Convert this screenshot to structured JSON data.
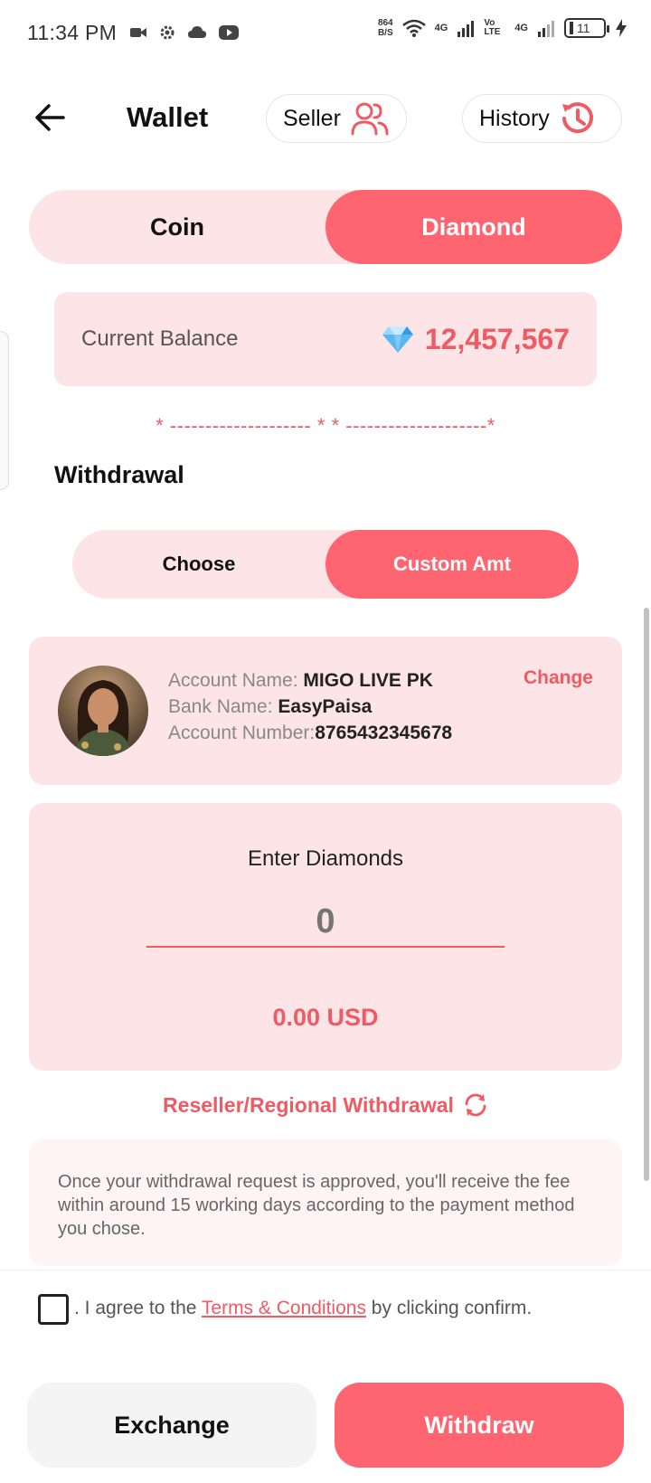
{
  "status_bar": {
    "time": "11:34 PM",
    "speed_value": "864",
    "speed_unit": "B/S",
    "net1": "4G",
    "net_volte": "Vo LTE",
    "net2": "4G",
    "battery": "11"
  },
  "header": {
    "title": "Wallet",
    "seller_label": "Seller",
    "history_label": "History"
  },
  "main_tabs": [
    {
      "label": "Coin",
      "active": false
    },
    {
      "label": "Diamond",
      "active": true
    }
  ],
  "balance": {
    "label": "Current Balance",
    "value": "12,457,567"
  },
  "divider_text": "* -------------------- * * --------------------*",
  "withdrawal": {
    "title": "Withdrawal",
    "tabs": [
      {
        "label": "Choose",
        "active": false
      },
      {
        "label": "Custom Amt",
        "active": true
      }
    ]
  },
  "account": {
    "name_label": "Account Name: ",
    "name_value": "MIGO LIVE PK",
    "bank_label": "Bank Name: ",
    "bank_value": "EasyPaisa",
    "number_label": "Account Number:",
    "number_value": "8765432345678",
    "change_label": "Change"
  },
  "enter": {
    "label": "Enter Diamonds",
    "placeholder": "0",
    "usd_value": "0.00 USD"
  },
  "reseller_label": "Reseller/Regional Withdrawal",
  "info_text": "Once your withdrawal request is approved, you'll receive the fee within around 15 working days according to the payment method you chose.",
  "terms": {
    "prefix": ". I agree to the ",
    "link": "Terms & Conditions",
    "suffix": " by clicking confirm."
  },
  "buttons": {
    "exchange": "Exchange",
    "withdraw": "Withdraw"
  },
  "colors": {
    "accent": "#fe6570",
    "accent_text": "#f05a63",
    "card_bg": "#fde5e7"
  }
}
